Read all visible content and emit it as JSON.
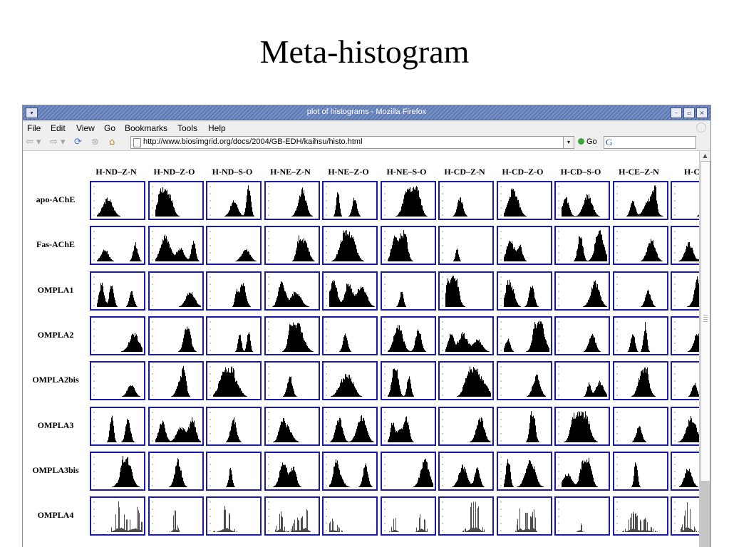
{
  "slide": {
    "title": "Meta-histogram"
  },
  "window": {
    "title": "plot of histograms - Mozilla Firefox"
  },
  "menubar": {
    "items": [
      "File",
      "Edit",
      "View",
      "Go",
      "Bookmarks",
      "Tools",
      "Help"
    ]
  },
  "navbar": {
    "url": "http://www.biosimgrid.org/docs/2004/GB-EDH/kaihsu/histo.html",
    "go_label": "Go",
    "search_placeholder": ""
  },
  "grid": {
    "columns": [
      "H-ND–Z-N",
      "H-ND–Z-O",
      "H-ND–S-O",
      "H-NE–Z-N",
      "H-NE–Z-O",
      "H-NE–S-O",
      "H-CD–Z-N",
      "H-CD–Z-O",
      "H-CD–S-O",
      "H-CE–Z-N",
      "H-CE–"
    ],
    "rows": [
      "apo-AChE",
      "Fas-AChE",
      "OMPLA1",
      "OMPLA2",
      "OMPLA2bis",
      "OMPLA3",
      "OMPLA3bis",
      "OMPLA4"
    ],
    "cell_border_color": "#1a1aa8",
    "histogram_color": "#000000"
  },
  "icons": {
    "back": "back-arrow-icon",
    "forward": "forward-arrow-icon",
    "reload": "reload-icon",
    "stop": "stop-icon",
    "home": "home-icon",
    "page": "page-icon",
    "go": "go-icon",
    "search_engine": "google-icon"
  }
}
